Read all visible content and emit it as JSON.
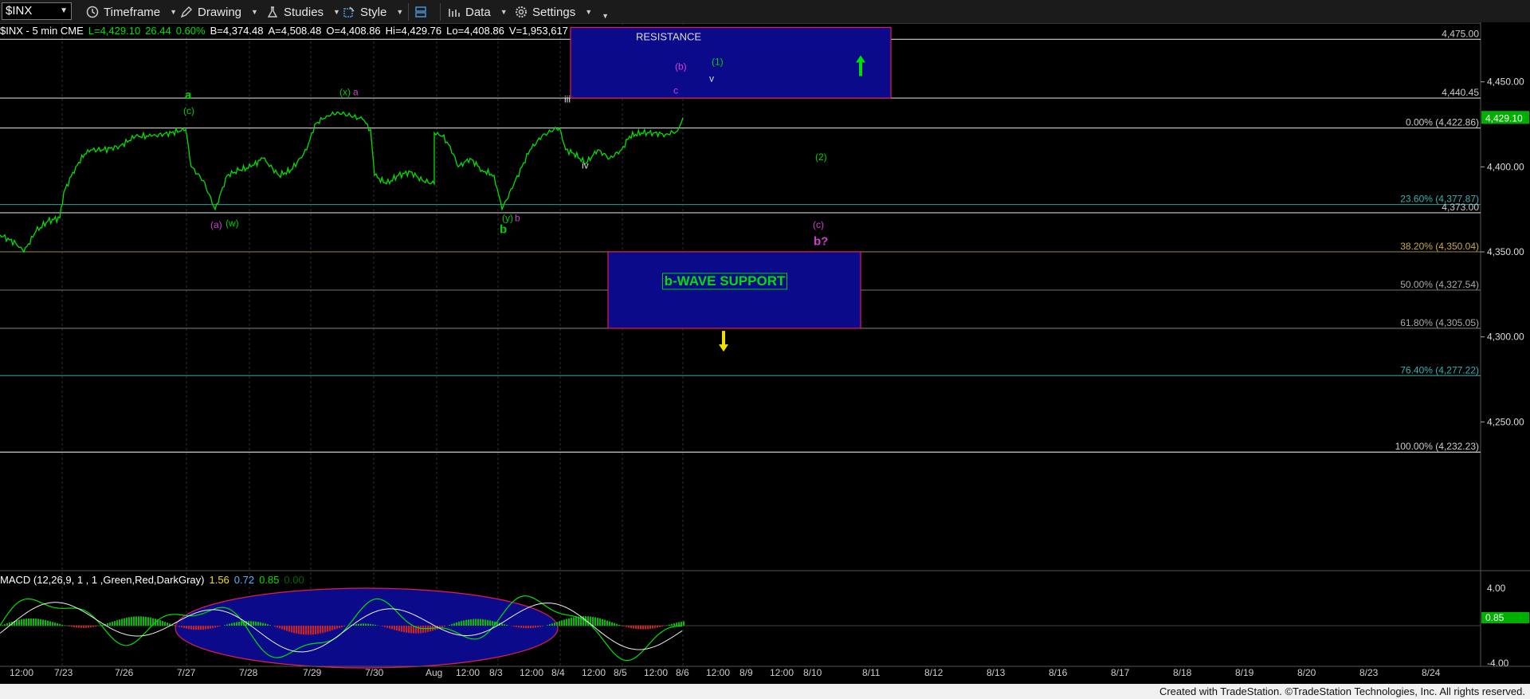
{
  "toolbar": {
    "symbol": "$INX",
    "timeframe_label": "Timeframe",
    "drawing_label": "Drawing",
    "studies_label": "Studies",
    "style_label": "Style",
    "data_label": "Data",
    "settings_label": "Settings"
  },
  "infobar": {
    "title": "$INX - 5 min  CME",
    "last": "L=4,429.10",
    "change": "26.44",
    "pct": "0.60%",
    "bid": "B=4,374.48",
    "ask": "A=4,508.48",
    "open": "O=4,408.86",
    "hi": "Hi=4,429.76",
    "lo": "Lo=4,408.86",
    "vol": "V=1,953,617"
  },
  "macd": {
    "legend": "MACD (12,26,9, 1 , 1 ,Green,Red,DarkGray)",
    "v1": "1.56",
    "v2": "0.72",
    "v3": "0.85",
    "v4": "0.00",
    "axis_top": "4.00",
    "axis_bottom": "-4.00",
    "current": "0.85"
  },
  "colors": {
    "price": "#00e000",
    "magenta": "#d040d0",
    "box_fill": "#0a0a8a",
    "box_border": "#e0204a",
    "fib_line": "#2aa0a0",
    "fib_gold": "#a08a30"
  },
  "chart_data": {
    "type": "line",
    "price_axis": {
      "ylim": [
        4200,
        4485
      ],
      "ticks": [
        "4,450.00",
        "4,400.00",
        "4,350.00",
        "4,300.00",
        "4,250.00"
      ],
      "tick_values": [
        4450,
        4400,
        4350,
        4300,
        4250
      ],
      "current_price": "4,429.10",
      "current_value": 4429.1
    },
    "x_labels": [
      "12:00",
      "7/23",
      "7/26",
      "7/27",
      "7/28",
      "7/29",
      "7/30",
      "Aug",
      "12:00",
      "8/3",
      "12:00",
      "8/4",
      "12:00",
      "8/5",
      "12:00",
      "8/6",
      "12:00",
      "8/9",
      "12:00",
      "8/10",
      "8/11",
      "8/12",
      "8/13",
      "8/16",
      "8/17",
      "8/18",
      "8/19",
      "8/20",
      "8/23",
      "8/24"
    ],
    "horizontal_levels": [
      {
        "label": "4,475.00",
        "value": 4475,
        "kind": "white"
      },
      {
        "label": "4,440.45",
        "value": 4440.45,
        "kind": "white"
      },
      {
        "label": "0.00% (4,422.86)",
        "value": 4422.86,
        "kind": "white"
      },
      {
        "label": "23.60% (4,377.87)",
        "value": 4377.87,
        "kind": "fib"
      },
      {
        "label": "4,373.00",
        "value": 4373,
        "kind": "white"
      },
      {
        "label": "38.20% (4,350.04)",
        "value": 4350.04,
        "kind": "gold"
      },
      {
        "label": "50.00% (4,327.54)",
        "value": 4327.54,
        "kind": "grey"
      },
      {
        "label": "61.80% (4,305.05)",
        "value": 4305.05,
        "kind": "grey"
      },
      {
        "label": "76.40% (4,277.22)",
        "value": 4277.22,
        "kind": "fib"
      },
      {
        "label": "100.00% (4,232.23)",
        "value": 4232.23,
        "kind": "white"
      }
    ],
    "price_path": [
      [
        0,
        4360
      ],
      [
        20,
        4355
      ],
      [
        30,
        4350
      ],
      [
        45,
        4362
      ],
      [
        60,
        4368
      ],
      [
        75,
        4370
      ],
      [
        80,
        4385
      ],
      [
        95,
        4400
      ],
      [
        110,
        4410
      ],
      [
        130,
        4410
      ],
      [
        150,
        4412
      ],
      [
        170,
        4418
      ],
      [
        190,
        4418
      ],
      [
        215,
        4420
      ],
      [
        233,
        4422
      ],
      [
        240,
        4400
      ],
      [
        255,
        4392
      ],
      [
        270,
        4375
      ],
      [
        285,
        4395
      ],
      [
        300,
        4398
      ],
      [
        315,
        4400
      ],
      [
        330,
        4405
      ],
      [
        350,
        4395
      ],
      [
        365,
        4398
      ],
      [
        385,
        4410
      ],
      [
        395,
        4425
      ],
      [
        410,
        4430
      ],
      [
        425,
        4432
      ],
      [
        440,
        4430
      ],
      [
        455,
        4428
      ],
      [
        465,
        4422
      ],
      [
        470,
        4395
      ],
      [
        485,
        4390
      ],
      [
        500,
        4395
      ],
      [
        515,
        4397
      ],
      [
        530,
        4392
      ],
      [
        545,
        4390
      ],
      [
        545,
        4420
      ],
      [
        555,
        4418
      ],
      [
        565,
        4412
      ],
      [
        575,
        4400
      ],
      [
        590,
        4405
      ],
      [
        605,
        4398
      ],
      [
        620,
        4395
      ],
      [
        630,
        4375
      ],
      [
        645,
        4390
      ],
      [
        655,
        4400
      ],
      [
        665,
        4410
      ],
      [
        680,
        4418
      ],
      [
        695,
        4422
      ],
      [
        702,
        4423
      ],
      [
        710,
        4410
      ],
      [
        720,
        4408
      ],
      [
        735,
        4402
      ],
      [
        750,
        4410
      ],
      [
        765,
        4405
      ],
      [
        780,
        4410
      ],
      [
        790,
        4418
      ],
      [
        805,
        4420
      ],
      [
        820,
        4420
      ],
      [
        835,
        4419
      ],
      [
        850,
        4421
      ],
      [
        857,
        4429
      ]
    ],
    "wave_labels": [
      {
        "text": "a",
        "value": 4440,
        "x": 232,
        "color": "green",
        "bold": true
      },
      {
        "text": "(c)",
        "value": 4431,
        "x": 230,
        "color": "green"
      },
      {
        "text": "(x)",
        "value": 4442,
        "x": 426,
        "color": "green"
      },
      {
        "text": "a",
        "value": 4442,
        "x": 443,
        "color": "magenta"
      },
      {
        "text": "(a)",
        "value": 4364,
        "x": 264,
        "color": "magenta"
      },
      {
        "text": "(w)",
        "value": 4365,
        "x": 283,
        "color": "green"
      },
      {
        "text": "(y)",
        "value": 4368,
        "x": 630,
        "color": "green"
      },
      {
        "text": "b",
        "value": 4368,
        "x": 646,
        "color": "magenta"
      },
      {
        "text": "b",
        "value": 4361,
        "x": 627,
        "color": "green",
        "bold": true
      },
      {
        "text": "iii",
        "value": 4438,
        "x": 708,
        "color": "white"
      },
      {
        "text": "iv",
        "value": 4399,
        "x": 730,
        "color": "white"
      },
      {
        "text": "c",
        "value": 4443,
        "x": 845,
        "color": "magenta"
      },
      {
        "text": "(b)",
        "value": 4457,
        "x": 847,
        "color": "magenta"
      },
      {
        "text": "(1)",
        "value": 4460,
        "x": 893,
        "color": "green"
      },
      {
        "text": "v",
        "value": 4450,
        "x": 890,
        "color": "white"
      },
      {
        "text": "(2)",
        "value": 4404,
        "x": 1023,
        "color": "green"
      },
      {
        "text": "(c)",
        "value": 4364,
        "x": 1020,
        "color": "magenta"
      },
      {
        "text": "b?",
        "value": 4354,
        "x": 1021,
        "color": "magenta",
        "bold": true
      }
    ],
    "boxes": [
      {
        "label": "RESISTANCE",
        "top": 4482,
        "bottom": 4440.45,
        "x1": 716,
        "x2": 1118
      },
      {
        "label": "b-WAVE SUPPORT",
        "top": 4350.04,
        "bottom": 4305.05,
        "x1": 763,
        "x2": 1080
      }
    ],
    "arrows": [
      {
        "direction": "up",
        "color": "#00dd00",
        "x": 1080,
        "value": 4460
      },
      {
        "direction": "down",
        "color": "#f0e000",
        "x": 908,
        "value": 4297
      }
    ]
  },
  "footer": "Created with TradeStation. ©TradeStation Technologies, Inc. All rights reserved."
}
